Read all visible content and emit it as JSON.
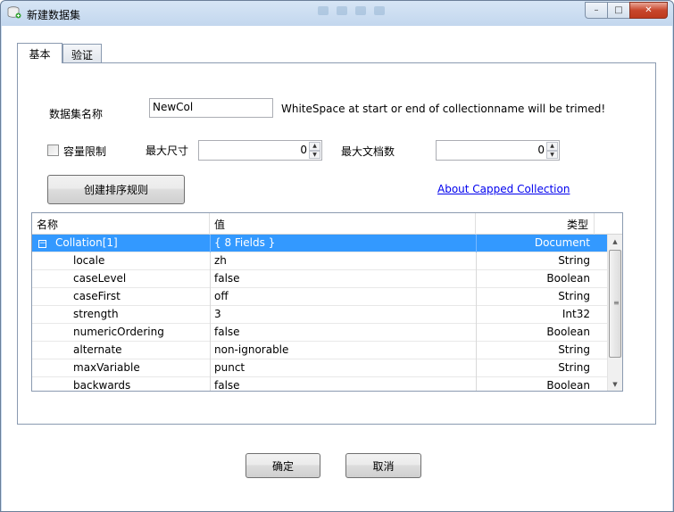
{
  "window": {
    "title": "新建数据集",
    "controls": {
      "minimize": "–",
      "maximize": "□",
      "close": "✕"
    }
  },
  "tabs": [
    {
      "label": "基本",
      "active": true
    },
    {
      "label": "验证",
      "active": false
    }
  ],
  "basic": {
    "name_label": "数据集名称",
    "name_value": "NewCol",
    "name_hint": "WhiteSpace at start or end of collectionname will be trimed!",
    "capped_label": "容量限制",
    "capped_checked": false,
    "max_size_label": "最大尺寸",
    "max_size_value": "0",
    "max_docs_label": "最大文档数",
    "max_docs_value": "0",
    "create_collation_button": "创建排序规则",
    "about_link": "About Capped Collection"
  },
  "grid": {
    "columns": [
      "名称",
      "值",
      "类型"
    ],
    "root": {
      "name": "Collation[1]",
      "value": "{ 8 Fields }",
      "type": "Document",
      "expander": "−"
    },
    "rows": [
      {
        "name": "locale",
        "value": "zh",
        "type": "String"
      },
      {
        "name": "caseLevel",
        "value": "false",
        "type": "Boolean"
      },
      {
        "name": "caseFirst",
        "value": "off",
        "type": "String"
      },
      {
        "name": "strength",
        "value": "3",
        "type": "Int32"
      },
      {
        "name": "numericOrdering",
        "value": "false",
        "type": "Boolean"
      },
      {
        "name": "alternate",
        "value": "non-ignorable",
        "type": "String"
      },
      {
        "name": "maxVariable",
        "value": "punct",
        "type": "String"
      },
      {
        "name": "backwards",
        "value": "false",
        "type": "Boolean"
      }
    ]
  },
  "footer": {
    "ok_button": "确定",
    "cancel_button": "取消"
  },
  "icons": {
    "app": "database-new-icon",
    "spin_up": "▲",
    "spin_down": "▼",
    "scroll_up": "▲",
    "scroll_down": "▼"
  },
  "colors": {
    "selection": "#3399ff",
    "link": "#0000ee",
    "close_button": "#c8462c"
  }
}
